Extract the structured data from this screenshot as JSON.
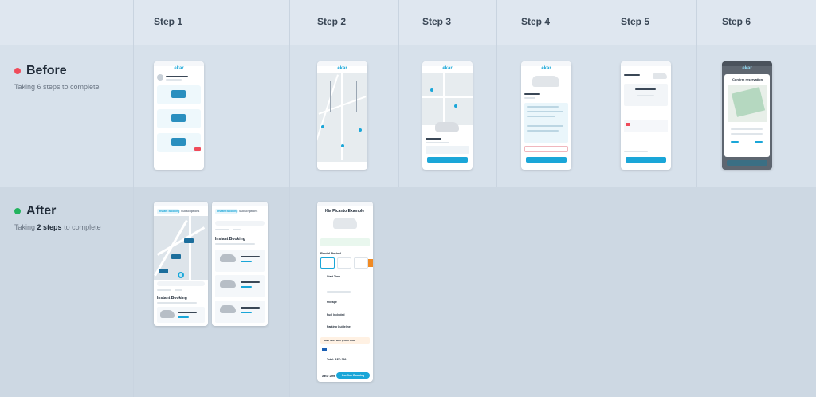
{
  "columns": [
    "Step 1",
    "Step 2",
    "Step 3",
    "Step 4",
    "Step 5",
    "Step 6"
  ],
  "rows": {
    "before": {
      "title": "Before",
      "subtitle": "Taking 6 steps to complete",
      "dot_color": "#ef4b5a"
    },
    "after": {
      "title": "After",
      "subtitle_prefix": "Taking ",
      "subtitle_bold": "2 steps",
      "subtitle_suffix": " to complete",
      "dot_color": "#22b35e"
    }
  },
  "screens": {
    "brand": "ekar",
    "before_step6_title": "Confirm reservation",
    "after_tab_instant": "Instant Booking",
    "after_tab_subscribe": "Subscriptions",
    "after_section": "Instant Booking",
    "after_search": "Search",
    "after_car_name": "Kia Picanto Example",
    "after_car_price": "AED 33",
    "after_rental_period": "Rental Period",
    "after_rows": [
      "Start Time",
      "1 hidden issue text",
      "Mileage",
      "Fuel Included",
      "Parking Guideline",
      "Save more with promo code",
      "Total: AED 299"
    ],
    "after_confirm": "Confirm Booking",
    "after_total": "AED 299"
  },
  "colors": {
    "accent": "#1aa6d8",
    "before_bg": "#dbe4ee",
    "after_bg": "#cdd8e3"
  }
}
